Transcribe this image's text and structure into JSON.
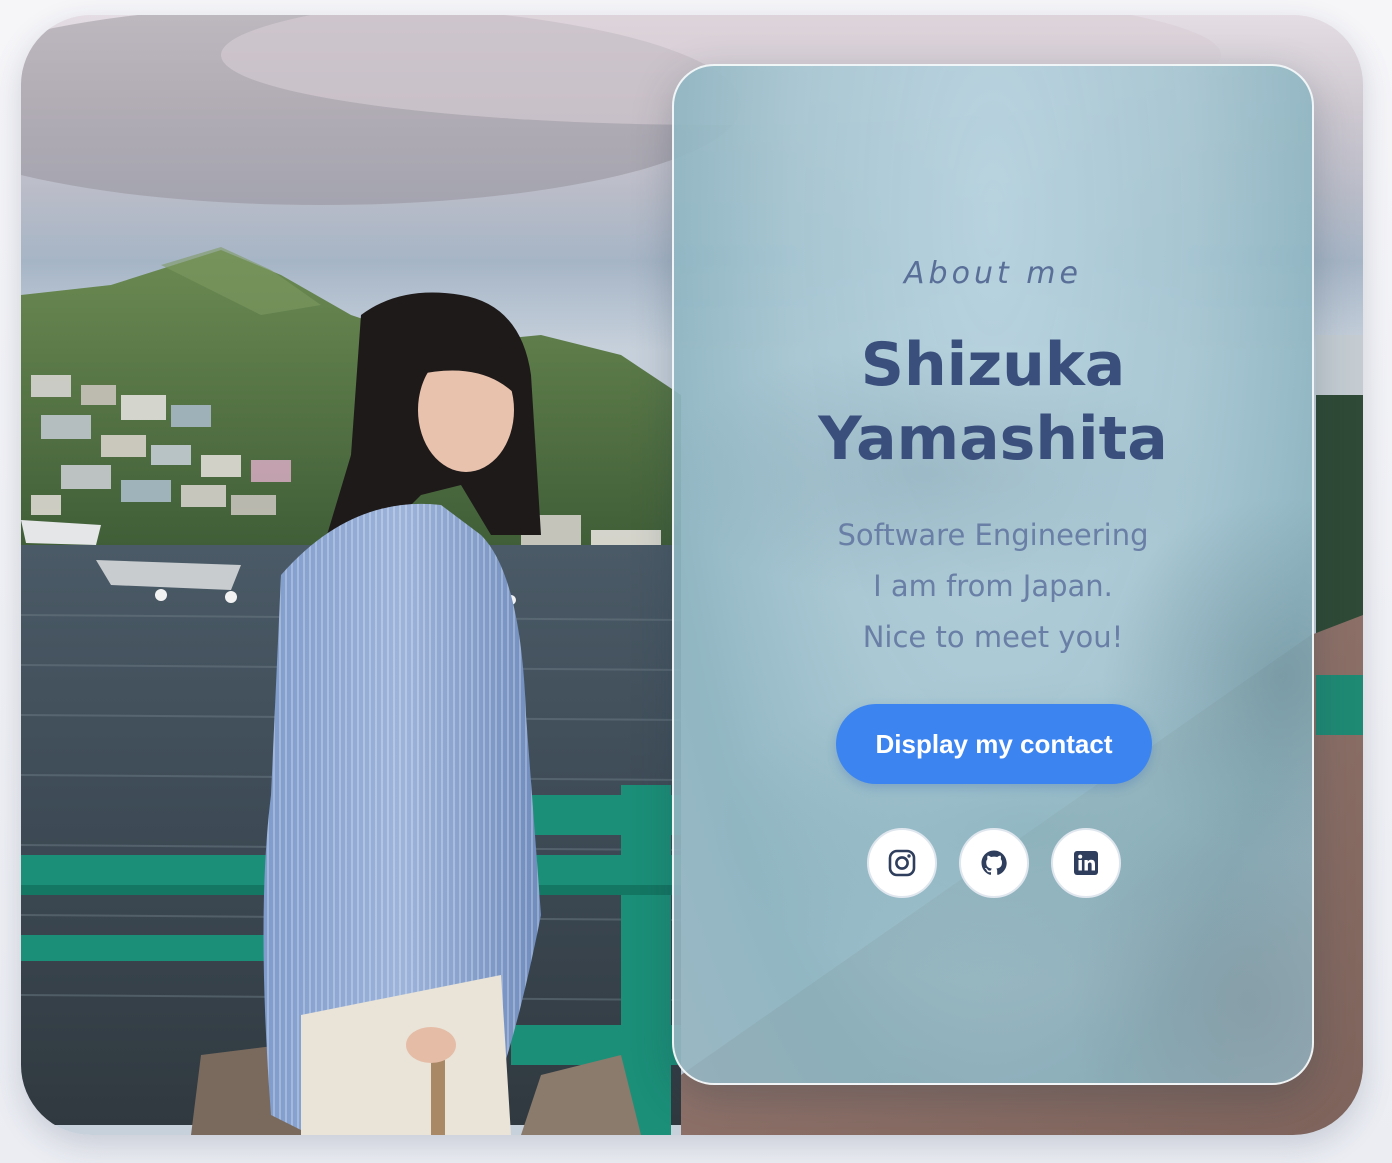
{
  "card": {
    "about_label": "About me",
    "name_line1": "Shizuka",
    "name_line2": "Yamashita",
    "bio": [
      "Software Engineering",
      "I am from Japan.",
      "Nice to meet you!"
    ],
    "contact_button": "Display my contact"
  },
  "socials": [
    {
      "icon": "instagram-icon"
    },
    {
      "icon": "github-icon"
    },
    {
      "icon": "linkedin-icon"
    }
  ],
  "colors": {
    "accent": "#3c84f0",
    "heading": "#3a4f7c",
    "subtle_text": "#6a7fa6",
    "icon": "#2f3e5c"
  }
}
